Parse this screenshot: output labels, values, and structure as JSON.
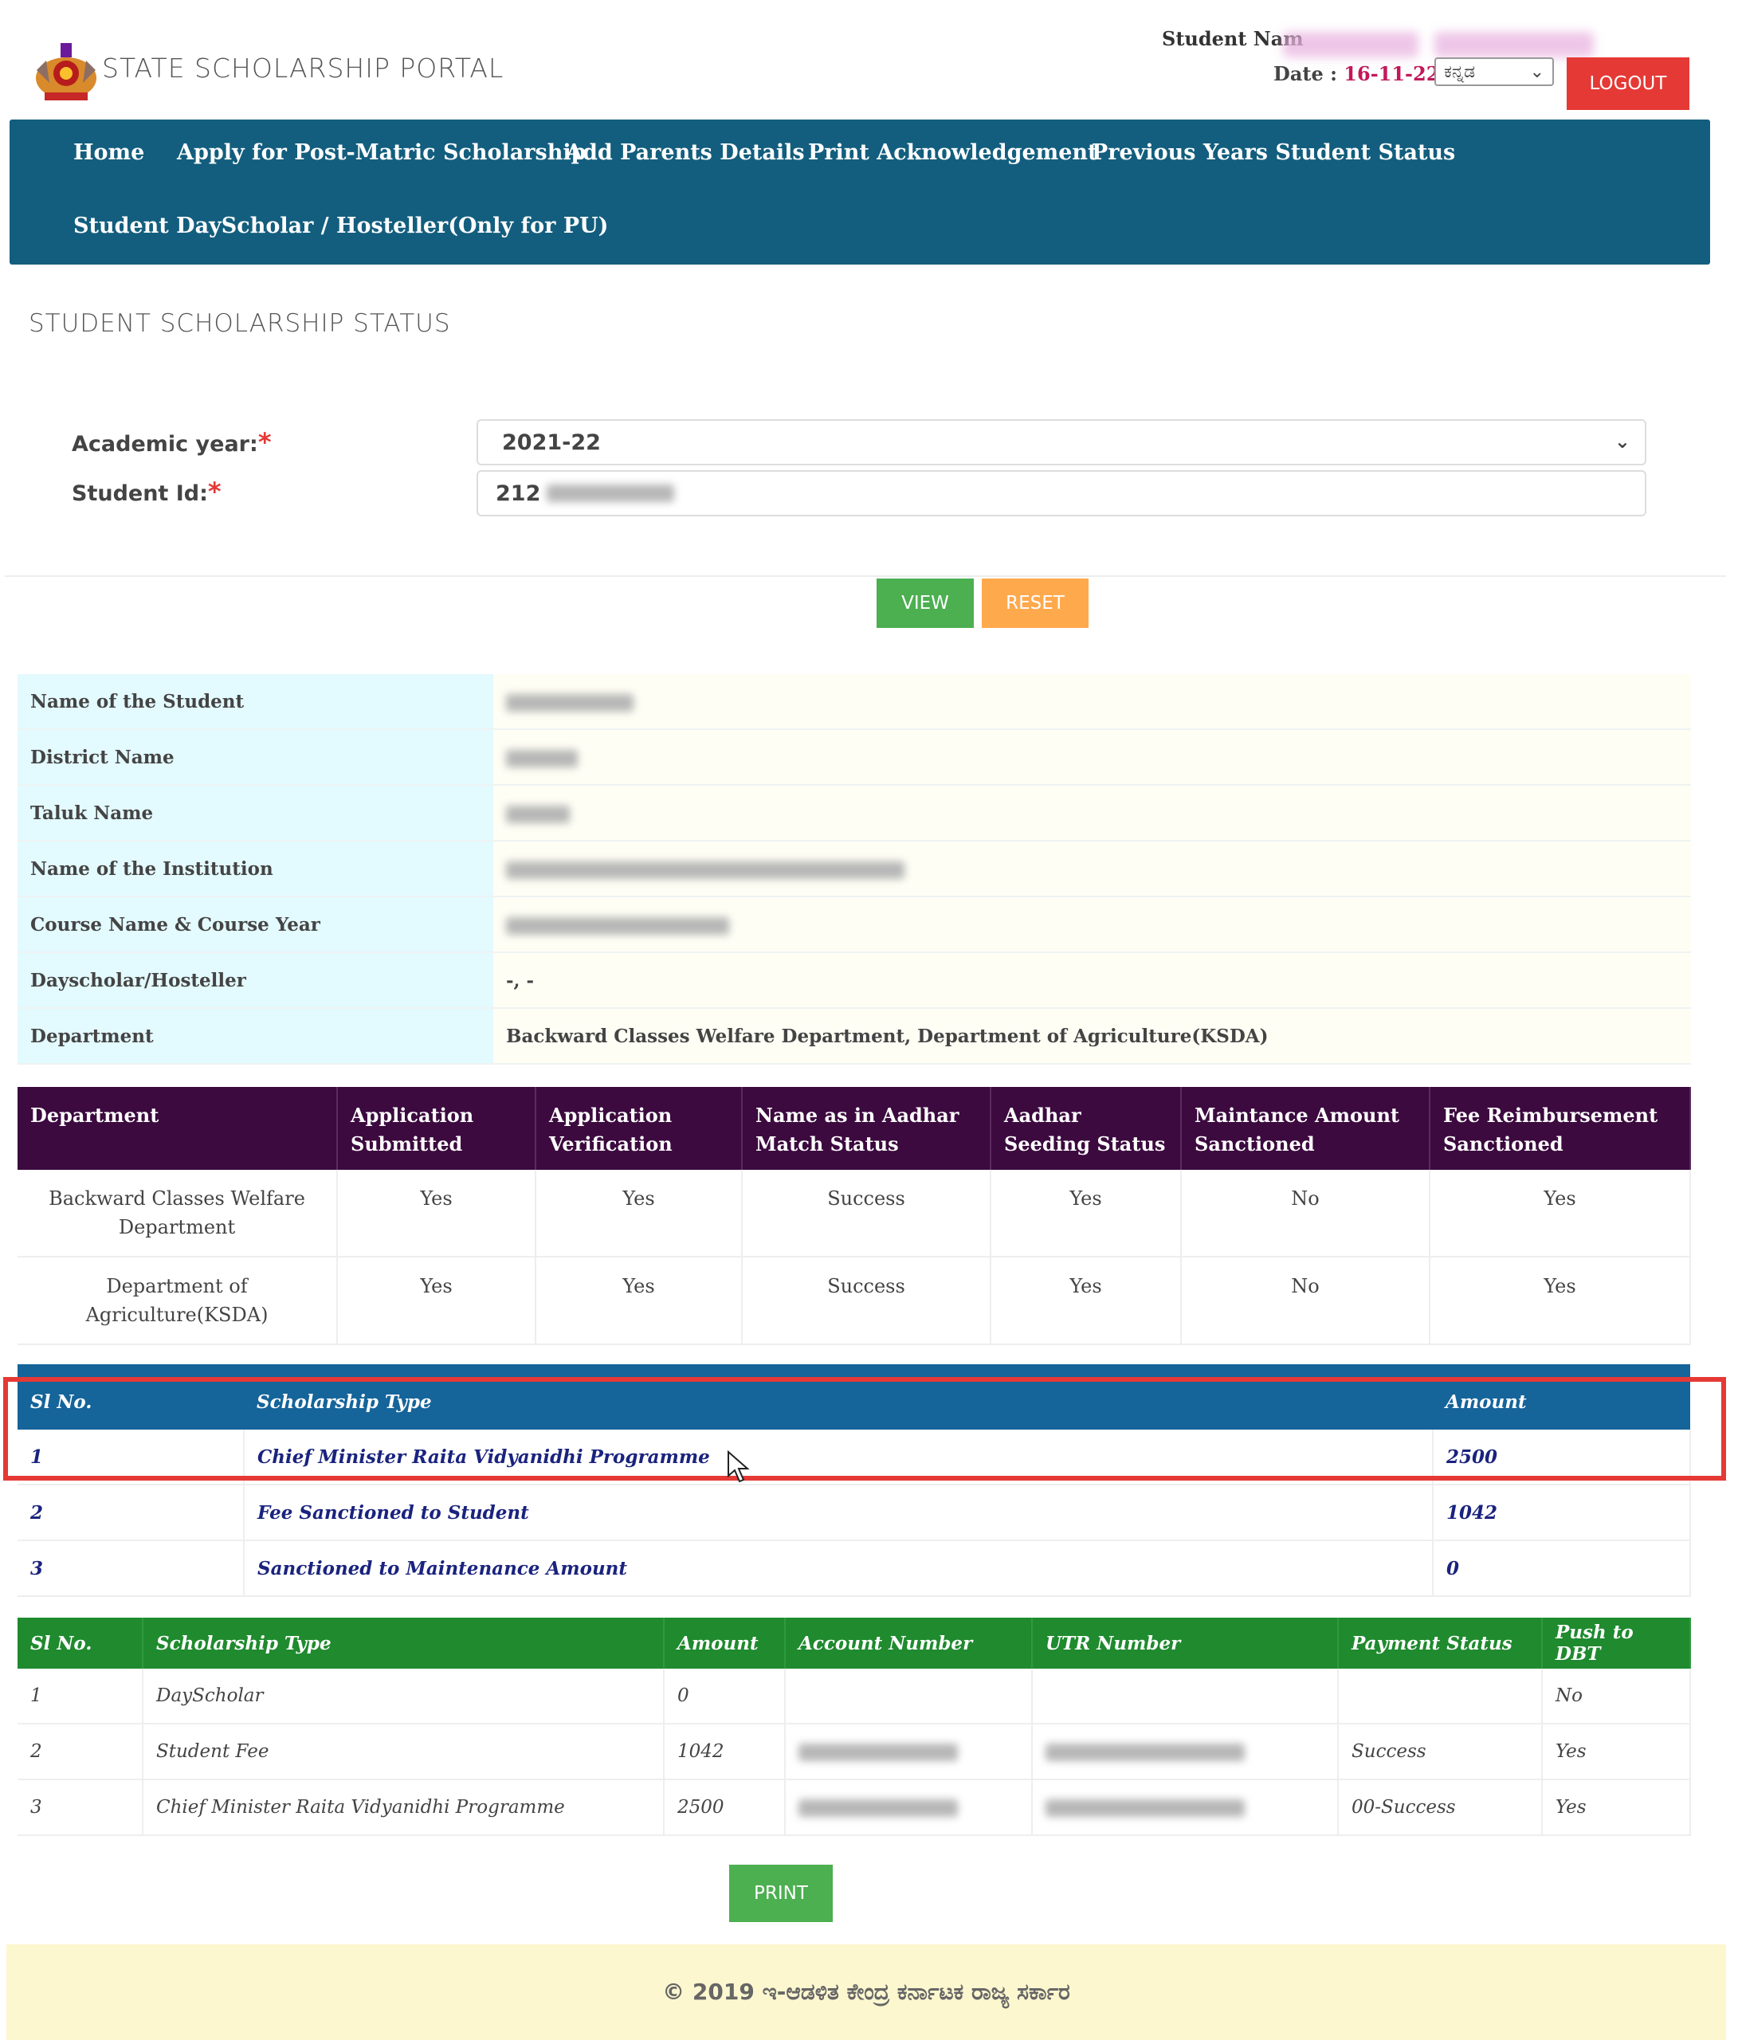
{
  "header": {
    "title": "STATE SCHOLARSHIP PORTAL",
    "student_name_label": "Student Nam",
    "date_label": "Date :",
    "date_value": "16-11-22",
    "language": "ಕನ್ನಡ",
    "logout_label": "LOGOUT"
  },
  "nav": {
    "items": [
      "Home",
      "Apply for Post-Matric Scholarship",
      "Add Parents Details",
      "Print Acknowledgement",
      "Previous Years Student Status",
      "Student DayScholar / Hosteller(Only for PU)"
    ]
  },
  "page": {
    "heading": "STUDENT SCHOLARSHIP STATUS",
    "academic_year_label": "Academic year:",
    "academic_year_value": "2021-22",
    "student_id_label": "Student Id:",
    "student_id_value": "212",
    "view_label": "VIEW",
    "reset_label": "RESET",
    "print_label": "PRINT"
  },
  "info": {
    "rows": [
      {
        "label": "Name of the Student"
      },
      {
        "label": "District Name"
      },
      {
        "label": "Taluk Name"
      },
      {
        "label": "Name of the Institution"
      },
      {
        "label": "Course Name & Course Year"
      },
      {
        "label": "Dayscholar/Hosteller",
        "value": "-, -"
      },
      {
        "label": "Department",
        "value": "Backward Classes Welfare Department, Department of Agriculture(KSDA)"
      }
    ]
  },
  "status_table": {
    "headers": [
      "Department",
      "Application Submitted",
      "Application Verification",
      "Name as in Aadhar Match Status",
      "Aadhar Seeding Status",
      "Maintance Amount Sanctioned",
      "Fee Reimbursement Sanctioned"
    ],
    "rows": [
      [
        "Backward Classes Welfare Department",
        "Yes",
        "Yes",
        "Success",
        "Yes",
        "No",
        "Yes"
      ],
      [
        "Department of Agriculture(KSDA)",
        "Yes",
        "Yes",
        "Success",
        "Yes",
        "No",
        "Yes"
      ]
    ]
  },
  "scholarship_table": {
    "headers": [
      "Sl No.",
      "Scholarship Type",
      "Amount"
    ],
    "rows": [
      [
        "1",
        "Chief Minister Raita Vidyanidhi Programme",
        "2500"
      ],
      [
        "2",
        "Fee Sanctioned to Student",
        "1042"
      ],
      [
        "3",
        "Sanctioned to Maintenance Amount",
        "0"
      ]
    ]
  },
  "payment_table": {
    "headers": [
      "Sl No.",
      "Scholarship Type",
      "Amount",
      "Account Number",
      "UTR Number",
      "Payment Status",
      "Push to DBT"
    ],
    "rows": [
      [
        "1",
        "DayScholar",
        "0",
        "",
        "",
        "",
        "No"
      ],
      [
        "2",
        "Student Fee",
        "1042",
        "",
        "",
        "Success",
        "Yes"
      ],
      [
        "3",
        "Chief Minister Raita Vidyanidhi Programme",
        "2500",
        "",
        "",
        "00-Success",
        "Yes"
      ]
    ]
  },
  "footer": {
    "text": "© 2019 ಇ-ಆಡಳಿತ ಕೇಂದ್ರ ಕರ್ನಾಟಕ ರಾಜ್ಯ ಸರ್ಕಾರ"
  },
  "colors": {
    "navbar": "#135e7e",
    "status_header": "#3c0a3f",
    "scholarship_header": "#15649a",
    "payment_header": "#1f8a2e",
    "highlight": "#e53935"
  }
}
